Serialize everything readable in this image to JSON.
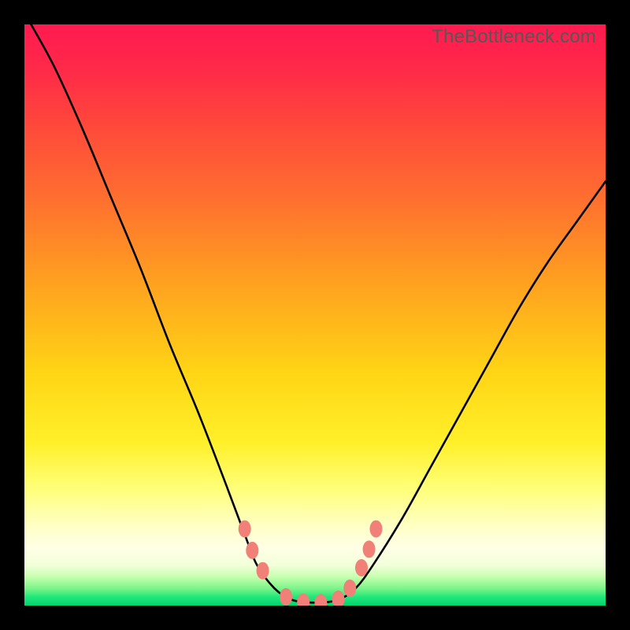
{
  "watermark": "TheBottleneck.com",
  "chart_data": {
    "type": "line",
    "title": "",
    "xlabel": "",
    "ylabel": "",
    "xlim": [
      0,
      1
    ],
    "ylim": [
      0,
      1
    ],
    "note": "Axes unlabeled; values are normalized 0-1 read from pixel positions (y=0 at bottom).",
    "series": [
      {
        "name": "curve",
        "x": [
          0.0,
          0.05,
          0.1,
          0.15,
          0.2,
          0.25,
          0.3,
          0.35,
          0.38,
          0.4,
          0.43,
          0.46,
          0.5,
          0.54,
          0.57,
          0.6,
          0.65,
          0.7,
          0.75,
          0.8,
          0.85,
          0.9,
          0.95,
          1.0
        ],
        "y": [
          1.02,
          0.93,
          0.82,
          0.7,
          0.58,
          0.45,
          0.33,
          0.2,
          0.12,
          0.07,
          0.03,
          0.01,
          0.005,
          0.01,
          0.03,
          0.07,
          0.15,
          0.24,
          0.33,
          0.42,
          0.51,
          0.59,
          0.66,
          0.73
        ]
      }
    ],
    "markers": {
      "name": "salmon-dots",
      "points_xy": [
        [
          0.379,
          0.132
        ],
        [
          0.392,
          0.095
        ],
        [
          0.41,
          0.06
        ],
        [
          0.45,
          0.015
        ],
        [
          0.48,
          0.006
        ],
        [
          0.51,
          0.005
        ],
        [
          0.54,
          0.011
        ],
        [
          0.56,
          0.03
        ],
        [
          0.58,
          0.065
        ],
        [
          0.593,
          0.097
        ],
        [
          0.605,
          0.132
        ]
      ]
    },
    "background_gradient": {
      "orientation": "vertical",
      "stops": [
        {
          "pos": 0.0,
          "color": "#ff1a50"
        },
        {
          "pos": 0.3,
          "color": "#ff6f2f"
        },
        {
          "pos": 0.6,
          "color": "#ffd515"
        },
        {
          "pos": 0.85,
          "color": "#ffffd0"
        },
        {
          "pos": 1.0,
          "color": "#00d66f"
        }
      ]
    }
  }
}
